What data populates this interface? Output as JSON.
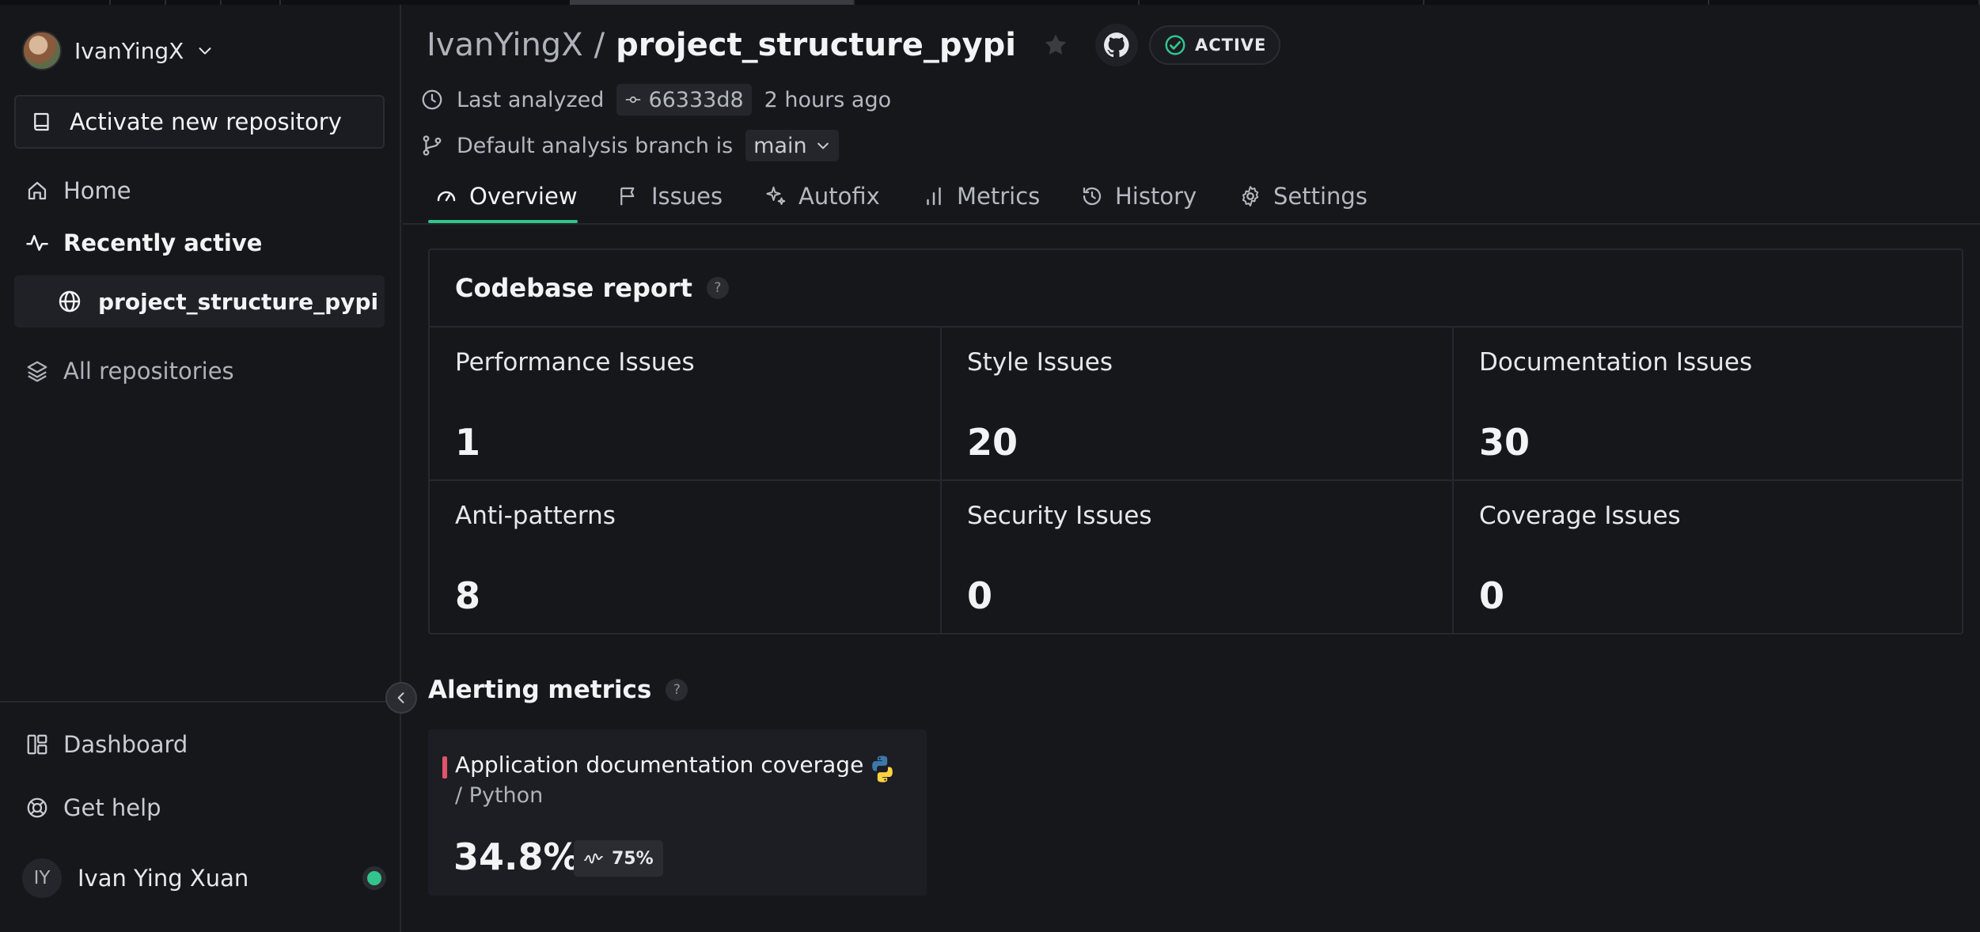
{
  "sidebar": {
    "account_name": "IvanYingX",
    "activate_label": "Activate new repository",
    "home_label": "Home",
    "recently_active_label": "Recently active",
    "recent_repo": "project_structure_pypi",
    "all_repos_label": "All repositories",
    "dashboard_label": "Dashboard",
    "help_label": "Get help",
    "user_initials": "IY",
    "user_name": "Ivan Ying Xuan",
    "status_color": "#33c48d"
  },
  "header": {
    "owner": "IvanYingX",
    "separator": "/",
    "repo": "project_structure_pypi",
    "badge": "ACTIVE",
    "last_analyzed_label": "Last analyzed",
    "commit": "66333d8",
    "analyzed_ago": "2 hours ago",
    "branch_label": "Default analysis branch is",
    "branch": "main"
  },
  "tabs": [
    {
      "label": "Overview",
      "icon": "gauge-icon"
    },
    {
      "label": "Issues",
      "icon": "flag-icon"
    },
    {
      "label": "Autofix",
      "icon": "sparkles-icon"
    },
    {
      "label": "Metrics",
      "icon": "bar-chart-icon"
    },
    {
      "label": "History",
      "icon": "history-icon"
    },
    {
      "label": "Settings",
      "icon": "gear-icon"
    }
  ],
  "active_tab": "Overview",
  "accent_color": "#33c48d",
  "report": {
    "title": "Codebase report",
    "help": "?",
    "cells": [
      {
        "label": "Performance Issues",
        "value": "1"
      },
      {
        "label": "Style Issues",
        "value": "20"
      },
      {
        "label": "Documentation Issues",
        "value": "30"
      },
      {
        "label": "Anti-patterns",
        "value": "8"
      },
      {
        "label": "Security Issues",
        "value": "0"
      },
      {
        "label": "Coverage Issues",
        "value": "0"
      }
    ]
  },
  "alerting": {
    "title": "Alerting metrics",
    "help": "?",
    "card": {
      "name": "Application documentation coverage",
      "sub": "/ Python",
      "value": "34.8%",
      "threshold": "75%",
      "bar_color": "#e0536a"
    }
  }
}
